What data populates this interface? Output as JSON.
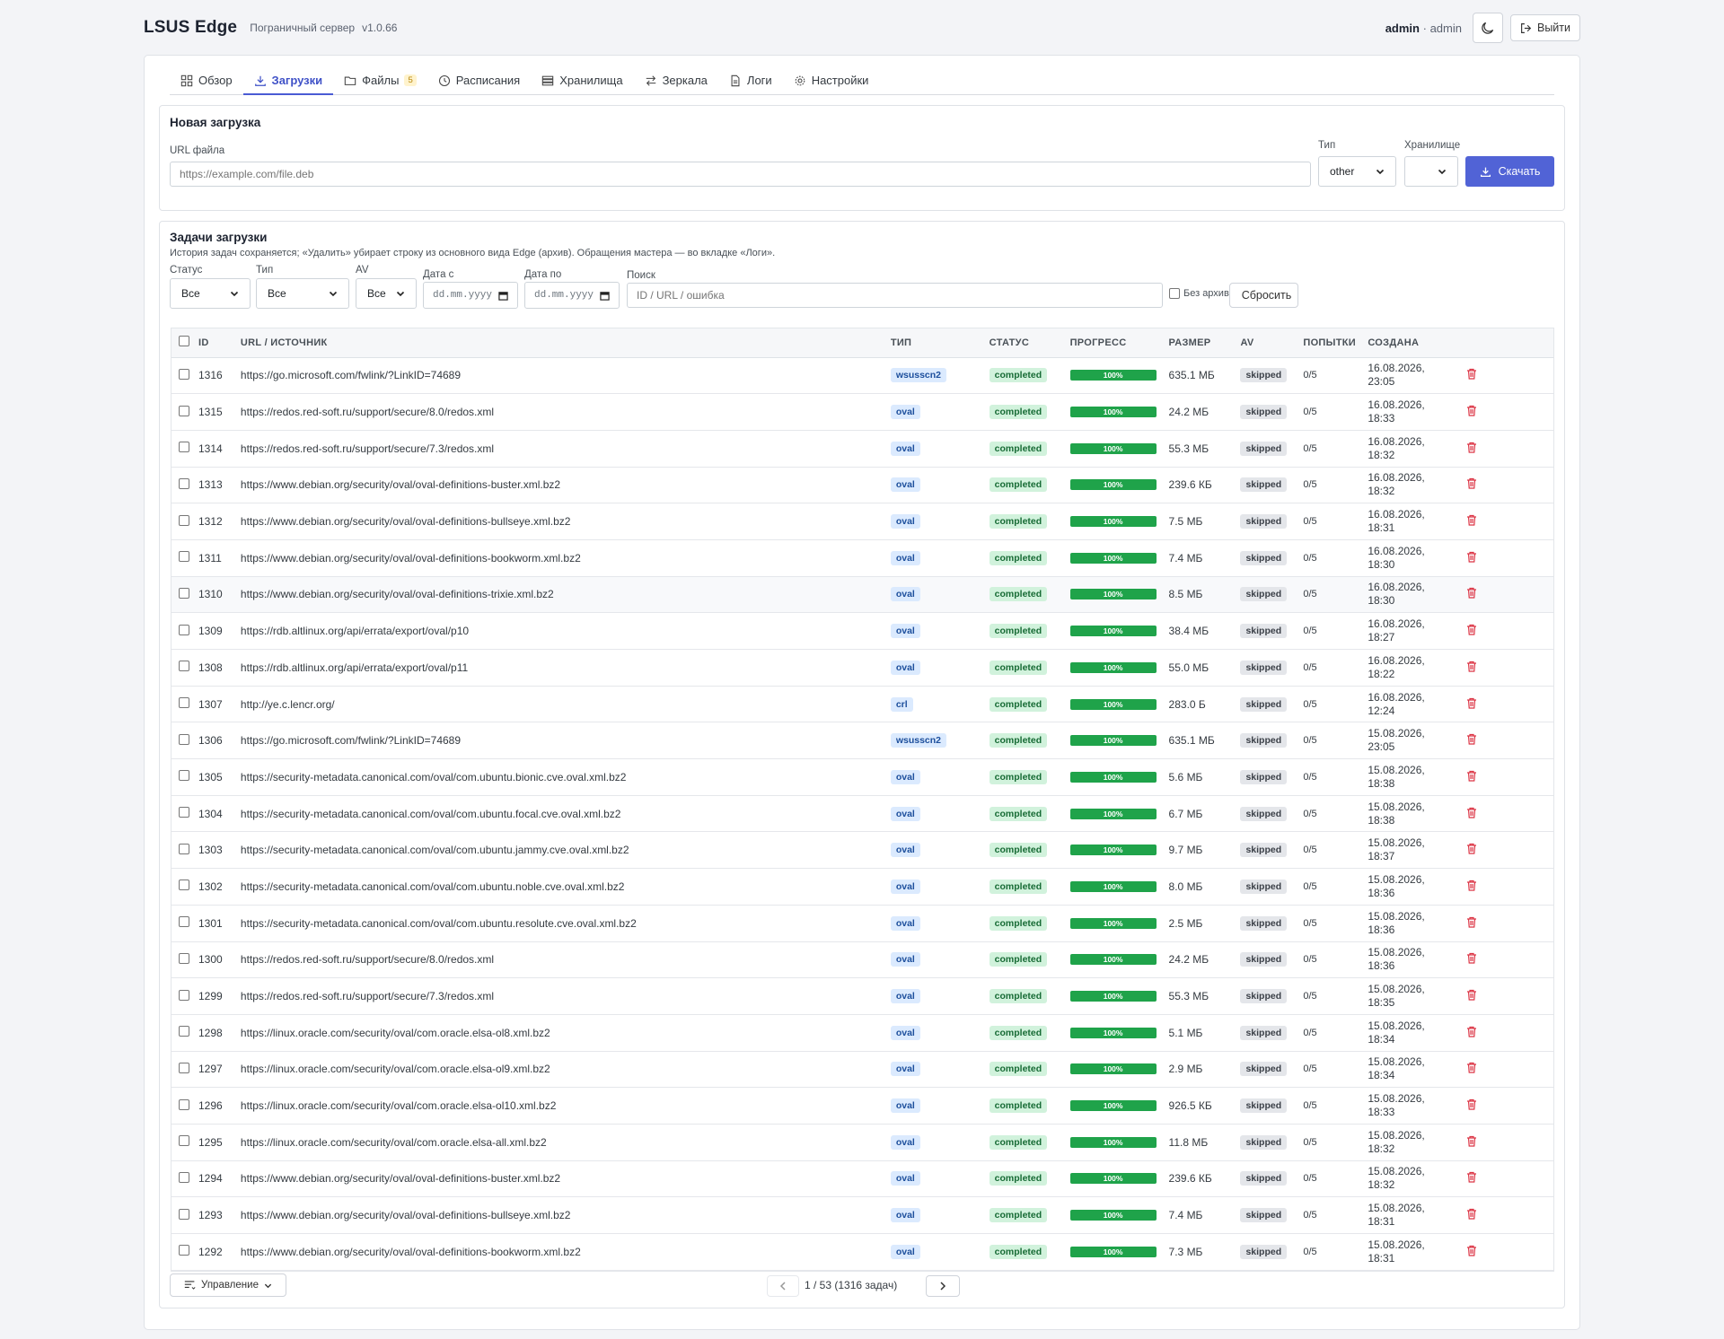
{
  "header": {
    "brand": "LSUS Edge",
    "subtitle": "Пограничный сервер",
    "version": "v1.0.66",
    "user_name": "admin",
    "user_sep": " · ",
    "user_role": "admin",
    "logout_label": "Выйти"
  },
  "tabs": [
    {
      "label": "Обзор",
      "icon": "grid-icon"
    },
    {
      "label": "Загрузки",
      "icon": "download-icon",
      "active": true
    },
    {
      "label": "Файлы",
      "icon": "folder-icon",
      "badge": "5"
    },
    {
      "label": "Расписания",
      "icon": "clock-icon"
    },
    {
      "label": "Хранилища",
      "icon": "storage-icon"
    },
    {
      "label": "Зеркала",
      "icon": "arrows-icon"
    },
    {
      "label": "Логи",
      "icon": "file-icon"
    },
    {
      "label": "Настройки",
      "icon": "gear-icon"
    }
  ],
  "new_download": {
    "title": "Новая загрузка",
    "url_label": "URL файла",
    "url_placeholder": "https://example.com/file.deb",
    "type_label": "Тип",
    "type_value": "other",
    "storage_label": "Хранилище",
    "storage_value": "",
    "submit_label": "Скачать"
  },
  "tasks": {
    "title": "Задачи загрузки",
    "description": "История задач сохраняется; «Удалить» убирает строку из основного вида Edge (архив). Обращения мастера — во вкладке «Логи».",
    "filters": {
      "status_label": "Статус",
      "status_value": "Все",
      "type_label": "Тип",
      "type_value": "Все",
      "av_label": "AV",
      "av_value": "Все",
      "date_from_label": "Дата с",
      "date_from_placeholder": "dd.mm.yyyy",
      "date_to_label": "Дата по",
      "date_to_placeholder": "dd.mm.yyyy",
      "search_label": "Поиск",
      "search_placeholder": "ID / URL / ошибка",
      "no_archive_label": "Без архива",
      "reset_label": "Сбросить"
    },
    "columns": [
      "ID",
      "URL / ИСТОЧНИК",
      "ТИП",
      "СТАТУС",
      "ПРОГРЕСС",
      "РАЗМЕР",
      "AV",
      "ПОПЫТКИ",
      "СОЗДАНА"
    ],
    "rows": [
      {
        "id": "1316",
        "url": "https://go.microsoft.com/fwlink/?LinkID=74689",
        "type": "wsusscn2",
        "status": "completed",
        "progress": "100%",
        "size": "635.1 МБ",
        "av": "skipped",
        "attempts": "0/5",
        "date": "16.08.2026,",
        "time": "23:05"
      },
      {
        "id": "1315",
        "url": "https://redos.red-soft.ru/support/secure/8.0/redos.xml",
        "type": "oval",
        "status": "completed",
        "progress": "100%",
        "size": "24.2 МБ",
        "av": "skipped",
        "attempts": "0/5",
        "date": "16.08.2026,",
        "time": "18:33"
      },
      {
        "id": "1314",
        "url": "https://redos.red-soft.ru/support/secure/7.3/redos.xml",
        "type": "oval",
        "status": "completed",
        "progress": "100%",
        "size": "55.3 МБ",
        "av": "skipped",
        "attempts": "0/5",
        "date": "16.08.2026,",
        "time": "18:32"
      },
      {
        "id": "1313",
        "url": "https://www.debian.org/security/oval/oval-definitions-buster.xml.bz2",
        "type": "oval",
        "status": "completed",
        "progress": "100%",
        "size": "239.6 КБ",
        "av": "skipped",
        "attempts": "0/5",
        "date": "16.08.2026,",
        "time": "18:32"
      },
      {
        "id": "1312",
        "url": "https://www.debian.org/security/oval/oval-definitions-bullseye.xml.bz2",
        "type": "oval",
        "status": "completed",
        "progress": "100%",
        "size": "7.5 МБ",
        "av": "skipped",
        "attempts": "0/5",
        "date": "16.08.2026,",
        "time": "18:31"
      },
      {
        "id": "1311",
        "url": "https://www.debian.org/security/oval/oval-definitions-bookworm.xml.bz2",
        "type": "oval",
        "status": "completed",
        "progress": "100%",
        "size": "7.4 МБ",
        "av": "skipped",
        "attempts": "0/5",
        "date": "16.08.2026,",
        "time": "18:30"
      },
      {
        "id": "1310",
        "url": "https://www.debian.org/security/oval/oval-definitions-trixie.xml.bz2",
        "type": "oval",
        "status": "completed",
        "progress": "100%",
        "size": "8.5 МБ",
        "av": "skipped",
        "attempts": "0/5",
        "date": "16.08.2026,",
        "time": "18:30",
        "highlight": true
      },
      {
        "id": "1309",
        "url": "https://rdb.altlinux.org/api/errata/export/oval/p10",
        "type": "oval",
        "status": "completed",
        "progress": "100%",
        "size": "38.4 МБ",
        "av": "skipped",
        "attempts": "0/5",
        "date": "16.08.2026,",
        "time": "18:27"
      },
      {
        "id": "1308",
        "url": "https://rdb.altlinux.org/api/errata/export/oval/p11",
        "type": "oval",
        "status": "completed",
        "progress": "100%",
        "size": "55.0 МБ",
        "av": "skipped",
        "attempts": "0/5",
        "date": "16.08.2026,",
        "time": "18:22"
      },
      {
        "id": "1307",
        "url": "http://ye.c.lencr.org/",
        "type": "crl",
        "status": "completed",
        "progress": "100%",
        "size": "283.0 Б",
        "av": "skipped",
        "attempts": "0/5",
        "date": "16.08.2026,",
        "time": "12:24"
      },
      {
        "id": "1306",
        "url": "https://go.microsoft.com/fwlink/?LinkID=74689",
        "type": "wsusscn2",
        "status": "completed",
        "progress": "100%",
        "size": "635.1 МБ",
        "av": "skipped",
        "attempts": "0/5",
        "date": "15.08.2026,",
        "time": "23:05"
      },
      {
        "id": "1305",
        "url": "https://security-metadata.canonical.com/oval/com.ubuntu.bionic.cve.oval.xml.bz2",
        "type": "oval",
        "status": "completed",
        "progress": "100%",
        "size": "5.6 МБ",
        "av": "skipped",
        "attempts": "0/5",
        "date": "15.08.2026,",
        "time": "18:38"
      },
      {
        "id": "1304",
        "url": "https://security-metadata.canonical.com/oval/com.ubuntu.focal.cve.oval.xml.bz2",
        "type": "oval",
        "status": "completed",
        "progress": "100%",
        "size": "6.7 МБ",
        "av": "skipped",
        "attempts": "0/5",
        "date": "15.08.2026,",
        "time": "18:38"
      },
      {
        "id": "1303",
        "url": "https://security-metadata.canonical.com/oval/com.ubuntu.jammy.cve.oval.xml.bz2",
        "type": "oval",
        "status": "completed",
        "progress": "100%",
        "size": "9.7 МБ",
        "av": "skipped",
        "attempts": "0/5",
        "date": "15.08.2026,",
        "time": "18:37"
      },
      {
        "id": "1302",
        "url": "https://security-metadata.canonical.com/oval/com.ubuntu.noble.cve.oval.xml.bz2",
        "type": "oval",
        "status": "completed",
        "progress": "100%",
        "size": "8.0 МБ",
        "av": "skipped",
        "attempts": "0/5",
        "date": "15.08.2026,",
        "time": "18:36"
      },
      {
        "id": "1301",
        "url": "https://security-metadata.canonical.com/oval/com.ubuntu.resolute.cve.oval.xml.bz2",
        "type": "oval",
        "status": "completed",
        "progress": "100%",
        "size": "2.5 МБ",
        "av": "skipped",
        "attempts": "0/5",
        "date": "15.08.2026,",
        "time": "18:36"
      },
      {
        "id": "1300",
        "url": "https://redos.red-soft.ru/support/secure/8.0/redos.xml",
        "type": "oval",
        "status": "completed",
        "progress": "100%",
        "size": "24.2 МБ",
        "av": "skipped",
        "attempts": "0/5",
        "date": "15.08.2026,",
        "time": "18:36"
      },
      {
        "id": "1299",
        "url": "https://redos.red-soft.ru/support/secure/7.3/redos.xml",
        "type": "oval",
        "status": "completed",
        "progress": "100%",
        "size": "55.3 МБ",
        "av": "skipped",
        "attempts": "0/5",
        "date": "15.08.2026,",
        "time": "18:35"
      },
      {
        "id": "1298",
        "url": "https://linux.oracle.com/security/oval/com.oracle.elsa-ol8.xml.bz2",
        "type": "oval",
        "status": "completed",
        "progress": "100%",
        "size": "5.1 МБ",
        "av": "skipped",
        "attempts": "0/5",
        "date": "15.08.2026,",
        "time": "18:34"
      },
      {
        "id": "1297",
        "url": "https://linux.oracle.com/security/oval/com.oracle.elsa-ol9.xml.bz2",
        "type": "oval",
        "status": "completed",
        "progress": "100%",
        "size": "2.9 МБ",
        "av": "skipped",
        "attempts": "0/5",
        "date": "15.08.2026,",
        "time": "18:34"
      },
      {
        "id": "1296",
        "url": "https://linux.oracle.com/security/oval/com.oracle.elsa-ol10.xml.bz2",
        "type": "oval",
        "status": "completed",
        "progress": "100%",
        "size": "926.5 КБ",
        "av": "skipped",
        "attempts": "0/5",
        "date": "15.08.2026,",
        "time": "18:33"
      },
      {
        "id": "1295",
        "url": "https://linux.oracle.com/security/oval/com.oracle.elsa-all.xml.bz2",
        "type": "oval",
        "status": "completed",
        "progress": "100%",
        "size": "11.8 МБ",
        "av": "skipped",
        "attempts": "0/5",
        "date": "15.08.2026,",
        "time": "18:32"
      },
      {
        "id": "1294",
        "url": "https://www.debian.org/security/oval/oval-definitions-buster.xml.bz2",
        "type": "oval",
        "status": "completed",
        "progress": "100%",
        "size": "239.6 КБ",
        "av": "skipped",
        "attempts": "0/5",
        "date": "15.08.2026,",
        "time": "18:32"
      },
      {
        "id": "1293",
        "url": "https://www.debian.org/security/oval/oval-definitions-bullseye.xml.bz2",
        "type": "oval",
        "status": "completed",
        "progress": "100%",
        "size": "7.4 МБ",
        "av": "skipped",
        "attempts": "0/5",
        "date": "15.08.2026,",
        "time": "18:31"
      },
      {
        "id": "1292",
        "url": "https://www.debian.org/security/oval/oval-definitions-bookworm.xml.bz2",
        "type": "oval",
        "status": "completed",
        "progress": "100%",
        "size": "7.3 МБ",
        "av": "skipped",
        "attempts": "0/5",
        "date": "15.08.2026,",
        "time": "18:31"
      }
    ],
    "manage_label": "Управление",
    "pagination": "1 / 53 (1316 задач)"
  },
  "colors": {
    "accent": "#5163d6",
    "progress": "#1fa34a",
    "delete": "#dc3545"
  }
}
